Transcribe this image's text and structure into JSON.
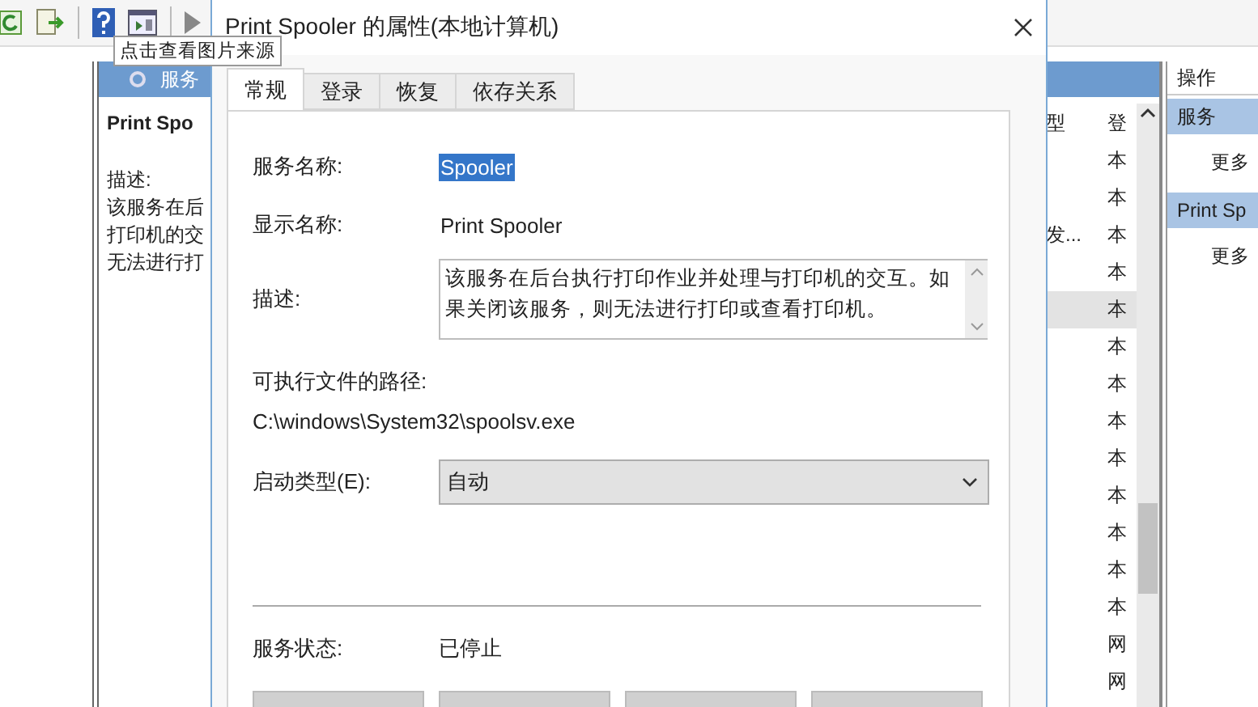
{
  "toolbar": {
    "tooltip": "点击查看图片来源"
  },
  "console": {
    "header": "服务",
    "detail": {
      "title": "Print Spo",
      "description_label": "描述:",
      "description_lines": [
        "该服务在后",
        "打印机的交",
        "无法进行打"
      ]
    },
    "columns": [
      "型",
      "登"
    ],
    "rows": [
      {
        "column_1": "",
        "column_2": "本",
        "selected": false
      },
      {
        "column_1": "",
        "column_2": "本",
        "selected": false
      },
      {
        "column_1": "发...",
        "column_2": "本",
        "selected": false
      },
      {
        "column_1": "",
        "column_2": "本",
        "selected": false
      },
      {
        "column_1": "",
        "column_2": "本",
        "selected": true
      },
      {
        "column_1": "",
        "column_2": "本",
        "selected": false
      },
      {
        "column_1": "",
        "column_2": "本",
        "selected": false
      },
      {
        "column_1": "",
        "column_2": "本",
        "selected": false
      },
      {
        "column_1": "",
        "column_2": "本",
        "selected": false
      },
      {
        "column_1": "",
        "column_2": "本",
        "selected": false
      },
      {
        "column_1": "",
        "column_2": "本",
        "selected": false
      },
      {
        "column_1": "",
        "column_2": "本",
        "selected": false
      },
      {
        "column_1": "",
        "column_2": "本",
        "selected": false
      },
      {
        "column_1": "",
        "column_2": "网",
        "selected": false
      },
      {
        "column_1": "",
        "column_2": "网",
        "selected": false
      }
    ]
  },
  "actions": {
    "header": "操作",
    "sections": [
      {
        "title": "服务",
        "items": [
          "更多"
        ]
      },
      {
        "title": "Print Sp",
        "items": [
          "更多"
        ]
      }
    ]
  },
  "dialog": {
    "title": "Print Spooler 的属性(本地计算机)",
    "tabs": [
      {
        "label": "常规",
        "selected": true
      },
      {
        "label": "登录",
        "selected": false
      },
      {
        "label": "恢复",
        "selected": false
      },
      {
        "label": "依存关系",
        "selected": false
      }
    ],
    "service_name": {
      "label": "服务名称:",
      "value": "Spooler",
      "selected": true
    },
    "display_name": {
      "label": "显示名称:",
      "value": "Print Spooler"
    },
    "description": {
      "label": "描述:",
      "value": "该服务在后台执行打印作业并处理与打印机的交互。如果关闭该服务，则无法进行打印或查看打印机。"
    },
    "path": {
      "label": "可执行文件的路径:",
      "value": "C:\\windows\\System32\\spoolsv.exe"
    },
    "startup_type": {
      "label": "启动类型(E):",
      "value": "自动"
    },
    "status": {
      "label": "服务状态:",
      "value": "已停止"
    },
    "buttons": [
      {
        "kind": "button"
      },
      {
        "kind": "button"
      },
      {
        "kind": "button"
      },
      {
        "kind": "button"
      }
    ]
  }
}
